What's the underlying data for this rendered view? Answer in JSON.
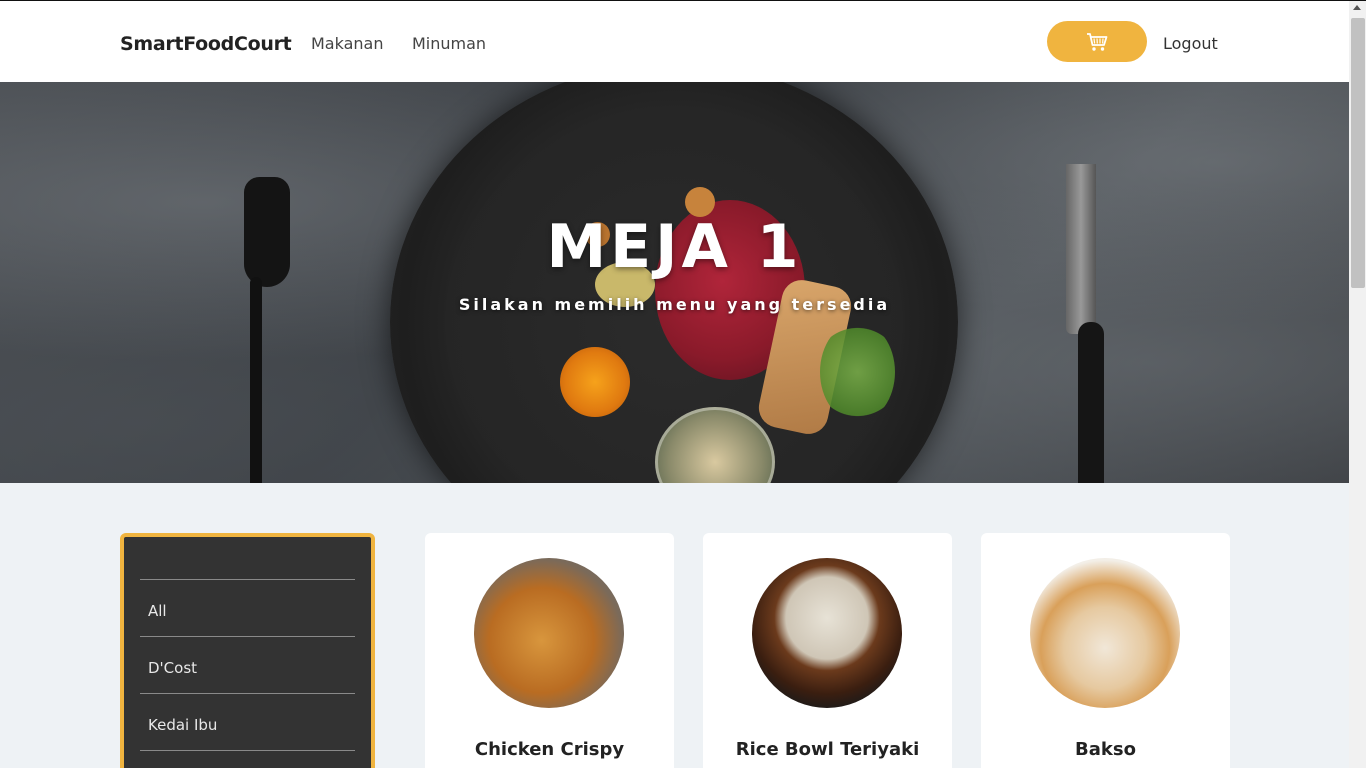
{
  "navbar": {
    "brand": "SmartFoodCourt",
    "links": [
      "Makanan",
      "Minuman"
    ],
    "cart_icon": "shopping-cart-icon",
    "logout_label": "Logout"
  },
  "hero": {
    "title": "MEJA 1",
    "subtitle": "Silakan memilih menu yang tersedia"
  },
  "categories": {
    "items": [
      "All",
      "D'Cost",
      "Kedai Ibu"
    ]
  },
  "products": [
    {
      "name": "Chicken Crispy"
    },
    {
      "name": "Rice Bowl Teriyaki"
    },
    {
      "name": "Bakso"
    }
  ],
  "colors": {
    "accent": "#f0b43f",
    "sidebar_bg": "#333333",
    "page_bg": "#eef2f5"
  }
}
